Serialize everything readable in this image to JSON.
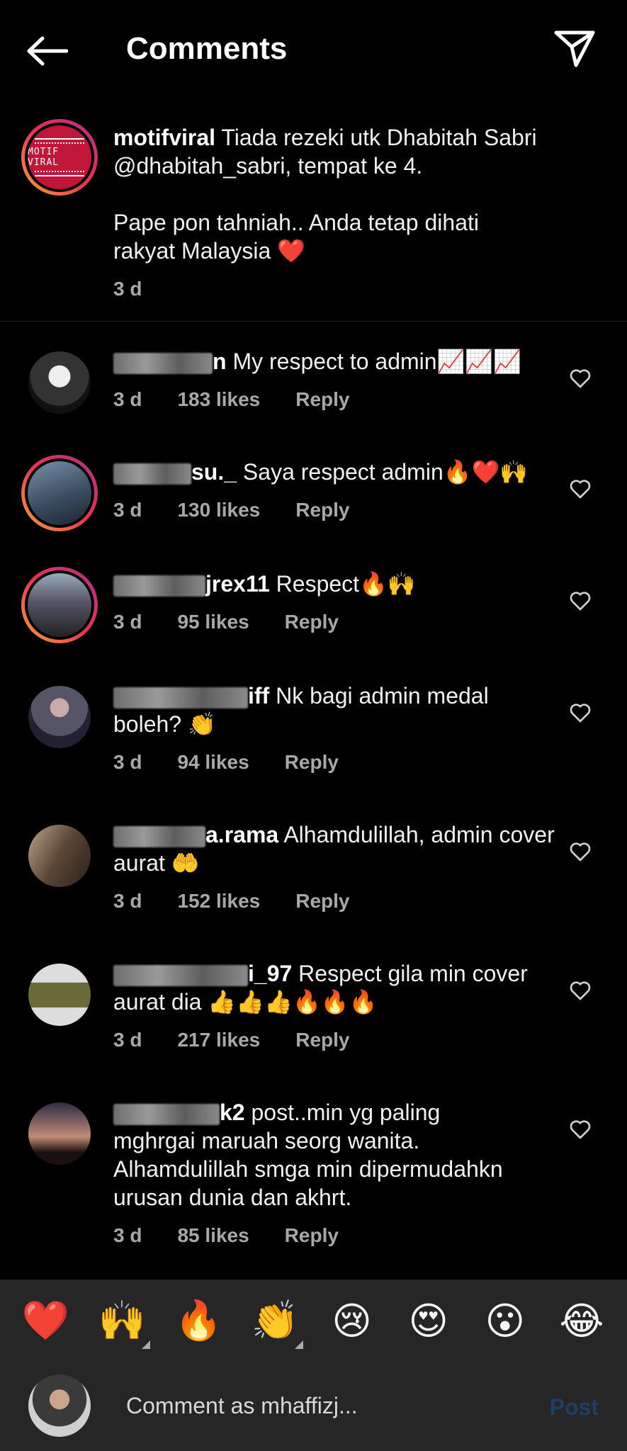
{
  "header": {
    "title": "Comments"
  },
  "caption": {
    "username": "motifviral",
    "text_line1": " Tiada rezeki utk Dhabitah Sabri",
    "text_line2": "@dhabitah_sabri, tempat ke 4.",
    "text_line3": "Pape pon tahniah.. Anda tetap dihati",
    "text_line4": "rakyat Malaysia ❤️",
    "time": "3 d",
    "avatar_text": "MOTIF VIRAL"
  },
  "comments": [
    {
      "username_visible": "n",
      "text": " My respect to admin📈📈📈",
      "time": "3 d",
      "likes": "183 likes",
      "reply": "Reply"
    },
    {
      "username_visible": "su._",
      "text": " Saya respect admin🔥❤️🙌",
      "time": "3 d",
      "likes": "130 likes",
      "reply": "Reply"
    },
    {
      "username_visible": "jrex11",
      "text": " Respect🔥🙌",
      "time": "3 d",
      "likes": "95 likes",
      "reply": "Reply"
    },
    {
      "username_visible": "iff",
      "text": " Nk bagi admin medal",
      "text2": "boleh? 👏",
      "time": "3 d",
      "likes": "94 likes",
      "reply": "Reply"
    },
    {
      "username_visible": "a.rama",
      "text": " Alhamdulillah, admin cover",
      "text2": "aurat 🤲",
      "time": "3 d",
      "likes": "152 likes",
      "reply": "Reply"
    },
    {
      "username_visible": "i_97",
      "text": " Respect gila min cover",
      "text2": "aurat dia 👍👍👍🔥🔥🔥",
      "time": "3 d",
      "likes": "217 likes",
      "reply": "Reply"
    },
    {
      "username_visible": "k2",
      "text": " post..min yg paling",
      "text2": "mghrgai maruah seorg wanita.",
      "text3": "Alhamdulillah smga min dipermudahkn",
      "text4": "urusan dunia dan akhrt.",
      "time": "3 d",
      "likes": "85 likes",
      "reply": "Reply"
    }
  ],
  "emoji_bar": [
    "❤️",
    "🙌",
    "🔥",
    "👏",
    "😢",
    "😍",
    "😮",
    "😂"
  ],
  "composer": {
    "placeholder": "Comment as mhaffizj...",
    "post_label": "Post"
  }
}
